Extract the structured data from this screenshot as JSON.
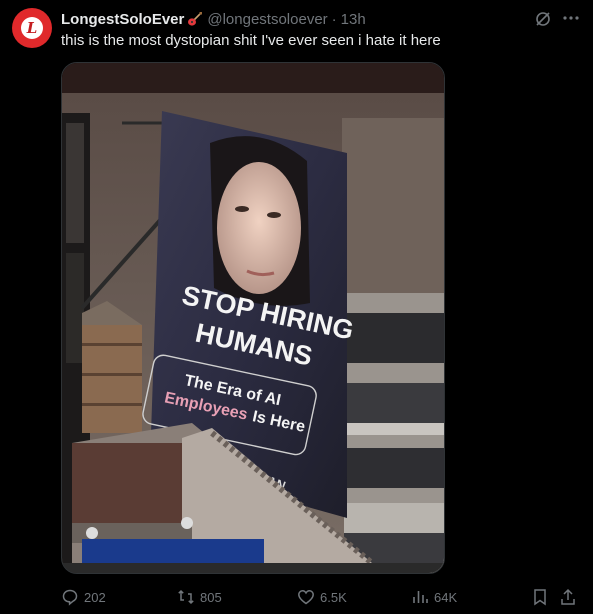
{
  "tweet": {
    "display_name": "LongestSoloEver",
    "name_emoji": "guitar-emoji",
    "handle": "@longestsoloever",
    "separator": "·",
    "time": "13h",
    "avatar_letter": "L",
    "text": "this is the most dystopian shit I've ever seen i hate it here"
  },
  "billboard": {
    "headline_1": "STOP HIRING",
    "headline_2": "HUMANS",
    "sub_1": "The Era of AI",
    "sub_2_pink": "Employees",
    "sub_2_white": "Is Here",
    "partial_sign": "AN"
  },
  "actions": {
    "replies": "202",
    "reposts": "805",
    "likes": "6.5K",
    "views": "64K"
  },
  "icons": [
    "grok-icon",
    "more-icon",
    "reply-icon",
    "retweet-icon",
    "like-icon",
    "views-icon",
    "bookmark-icon",
    "share-icon"
  ],
  "colors": {
    "avatar": "#e0292b",
    "muted": "#71767b",
    "accent_pink": "#e8a0b5"
  }
}
